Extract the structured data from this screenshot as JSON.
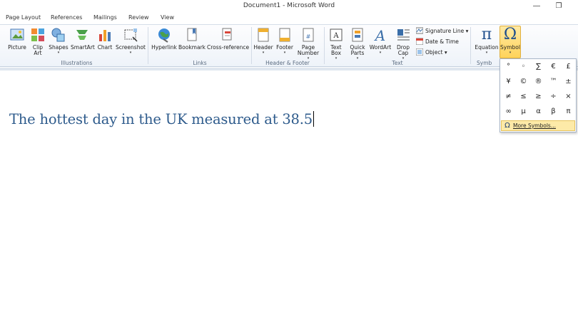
{
  "window": {
    "title": "Document1 - Microsoft Word",
    "minimize": "—",
    "restore": "❐"
  },
  "tabs": [
    "Page Layout",
    "References",
    "Mailings",
    "Review",
    "View"
  ],
  "ribbon": {
    "illustrations": {
      "label": "Illustrations",
      "buttons": [
        "Picture",
        "Clip\nArt",
        "Shapes",
        "SmartArt",
        "Chart",
        "Screenshot"
      ]
    },
    "links": {
      "label": "Links",
      "buttons": [
        "Hyperlink",
        "Bookmark",
        "Cross-reference"
      ]
    },
    "header_footer": {
      "label": "Header & Footer",
      "buttons": [
        "Header",
        "Footer",
        "Page\nNumber"
      ]
    },
    "text": {
      "label": "Text",
      "buttons": [
        "Text\nBox",
        "Quick\nParts",
        "WordArt",
        "Drop\nCap"
      ],
      "small": [
        "Signature Line",
        "Date & Time",
        "Object"
      ]
    },
    "symbols": {
      "label": "Symb",
      "buttons": [
        "Equation",
        "Symbol"
      ],
      "icons": [
        "π",
        "Ω"
      ]
    },
    "dropdown_arrow": "▾"
  },
  "document": {
    "text": "The hottest day in the UK measured at 38.5"
  },
  "symbol_dropdown": {
    "symbols": [
      "°",
      "◦",
      "∑",
      "€",
      "£",
      "¥",
      "©",
      "®",
      "™",
      "±",
      "≠",
      "≤",
      "≥",
      "÷",
      "×",
      "∞",
      "µ",
      "α",
      "β",
      "π"
    ],
    "more_icon": "Ω",
    "more_label": "More Symbols..."
  },
  "colors": {
    "doc_text": "#2e5b8c",
    "highlight": "#ffd35a"
  }
}
